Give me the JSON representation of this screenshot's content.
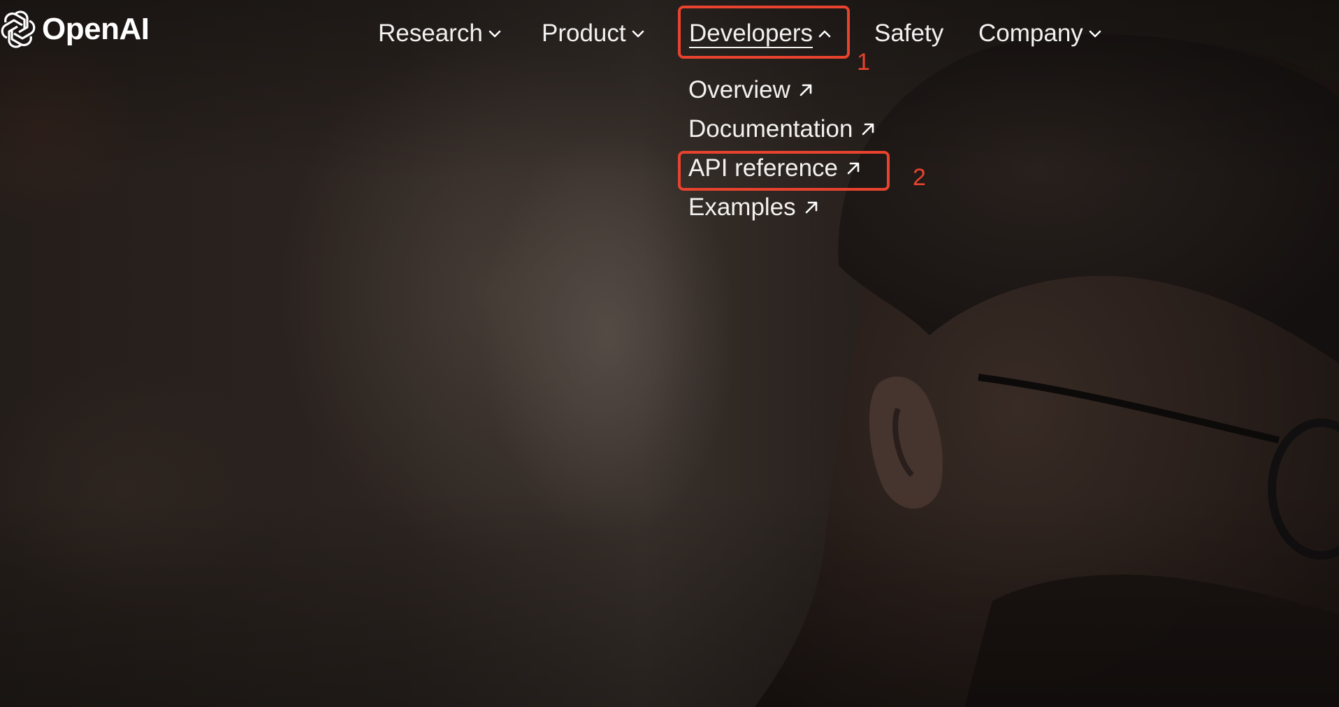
{
  "brand": {
    "name": "OpenAI",
    "logo_icon": "openai-knot-icon"
  },
  "nav": {
    "items": [
      {
        "label": "Research",
        "icon": "chevron-down-icon"
      },
      {
        "label": "Product",
        "icon": "chevron-down-icon"
      },
      {
        "label": "Developers",
        "icon": "chevron-up-icon",
        "expanded": true
      },
      {
        "label": "Safety"
      },
      {
        "label": "Company",
        "icon": "chevron-down-icon"
      }
    ]
  },
  "developers_menu": {
    "items": [
      {
        "label": "Overview",
        "icon": "external-arrow-icon"
      },
      {
        "label": "Documentation",
        "icon": "external-arrow-icon"
      },
      {
        "label": "API reference",
        "icon": "external-arrow-icon"
      },
      {
        "label": "Examples",
        "icon": "external-arrow-icon"
      }
    ]
  },
  "annotations": {
    "marker_1": "1",
    "marker_2": "2",
    "color": "#e8432e"
  },
  "theme": {
    "text_color": "#ffffff",
    "background": "#1d1815"
  }
}
